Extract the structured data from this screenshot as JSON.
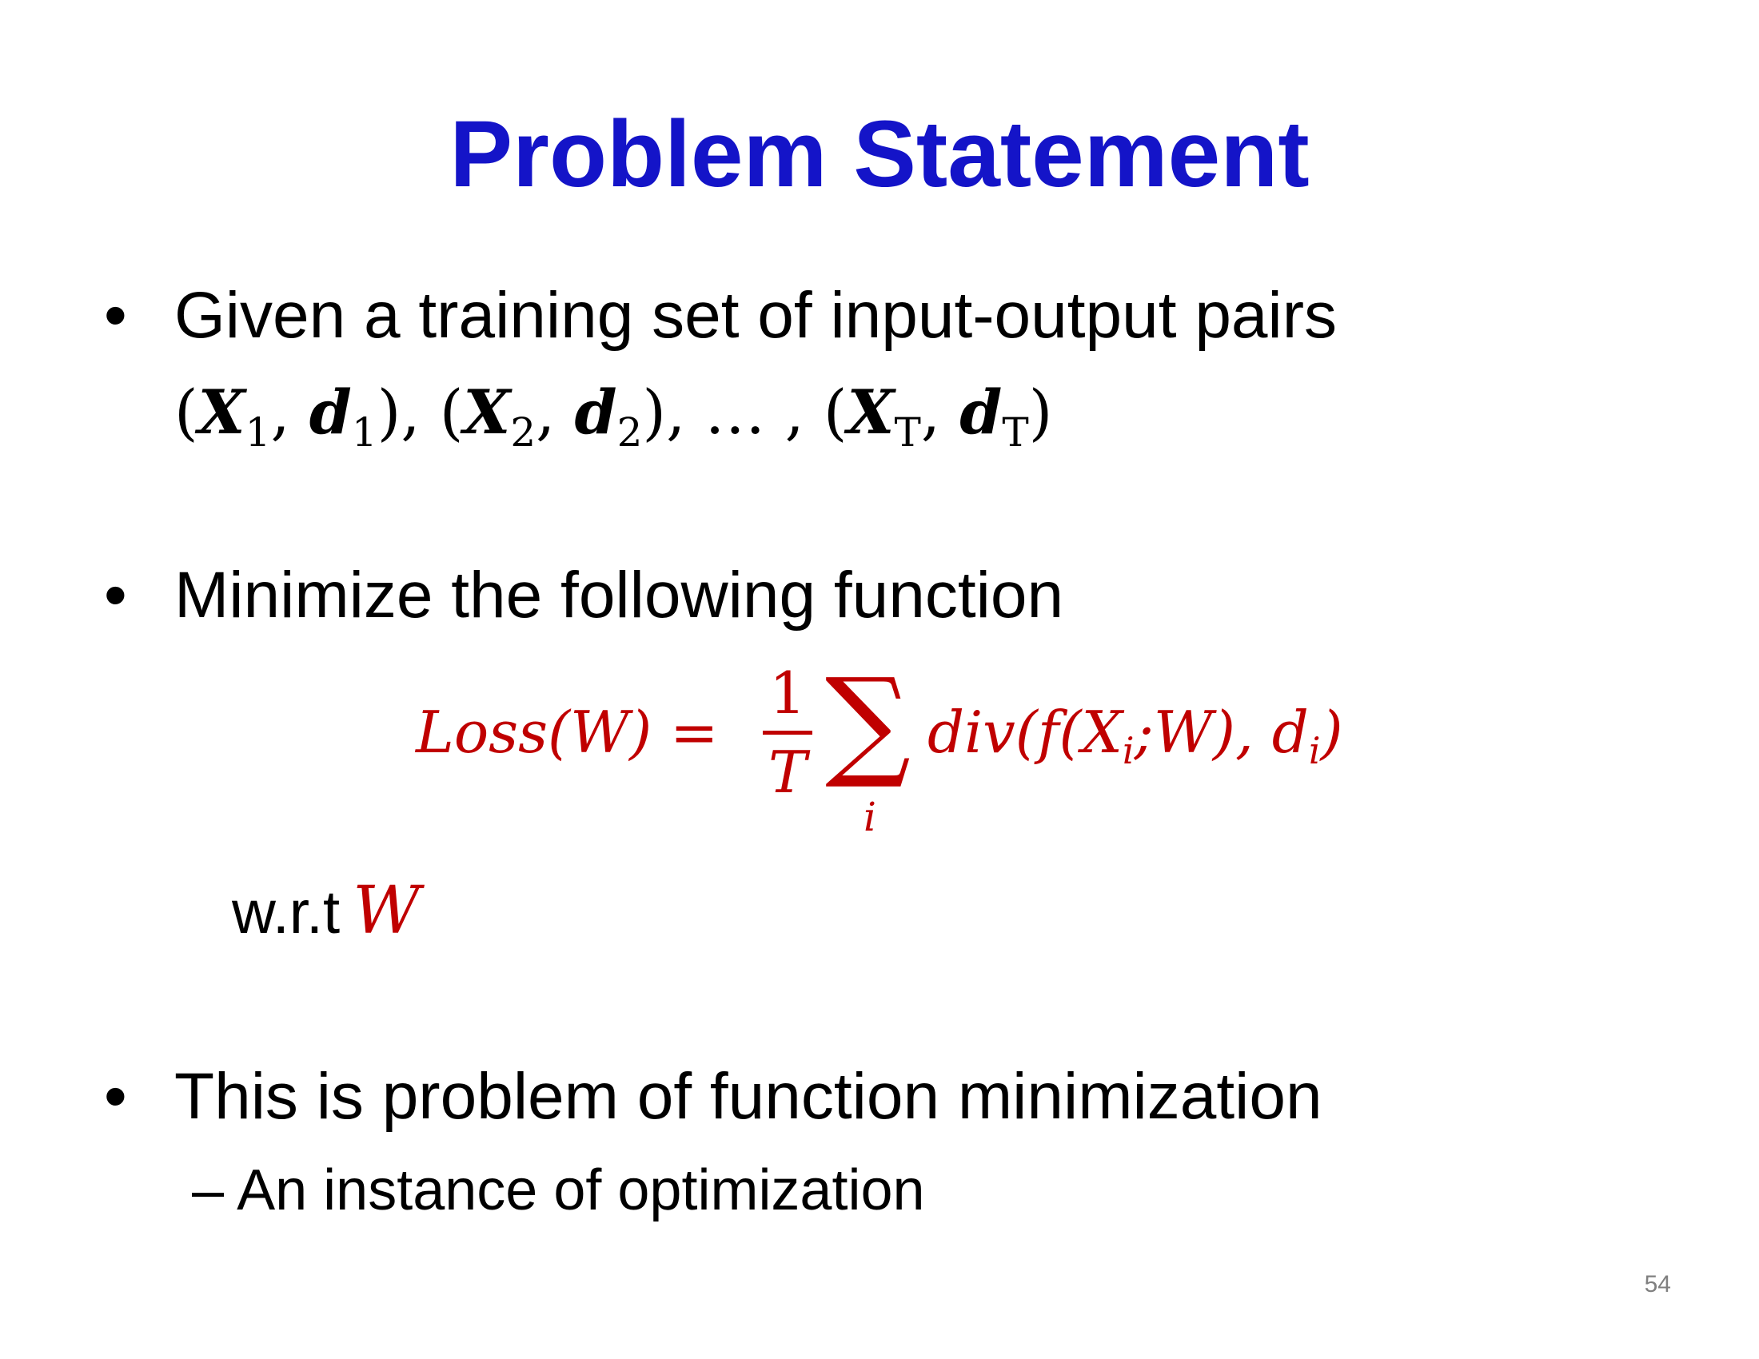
{
  "slide": {
    "title": "Problem Statement",
    "bullets": [
      {
        "text": "Given a training set of input-output pairs",
        "pairs": {
          "open": "(",
          "items": [
            {
              "x": "X",
              "xsub": "1",
              "d": "d",
              "dsub": "1"
            },
            {
              "x": "X",
              "xsub": "2",
              "d": "d",
              "dsub": "2"
            },
            {
              "x": "X",
              "xsub": "T",
              "d": "d",
              "dsub": "T"
            }
          ],
          "ellipsis": "…"
        }
      },
      {
        "text": "Minimize the following function",
        "formula": {
          "lhs": "Loss(W) =",
          "numerator": "1",
          "denominator": "T",
          "sigma": "∑",
          "sigma_sub": "i",
          "rhs_main": "div(f(X",
          "rhs_sub1": "i",
          "rhs_mid": ";W), d",
          "rhs_sub2": "i",
          "rhs_end": ")"
        },
        "wrt_label": "w.r.t",
        "wrt_var": "W"
      },
      {
        "text": "This is problem of function minimization",
        "sub_bullet": "An instance of optimization",
        "sub_dash": "–"
      }
    ],
    "bullet_glyph": "•",
    "page_number": "54",
    "colors": {
      "title": "#1414c8",
      "formula": "#c00000",
      "page_number": "#808080"
    }
  }
}
